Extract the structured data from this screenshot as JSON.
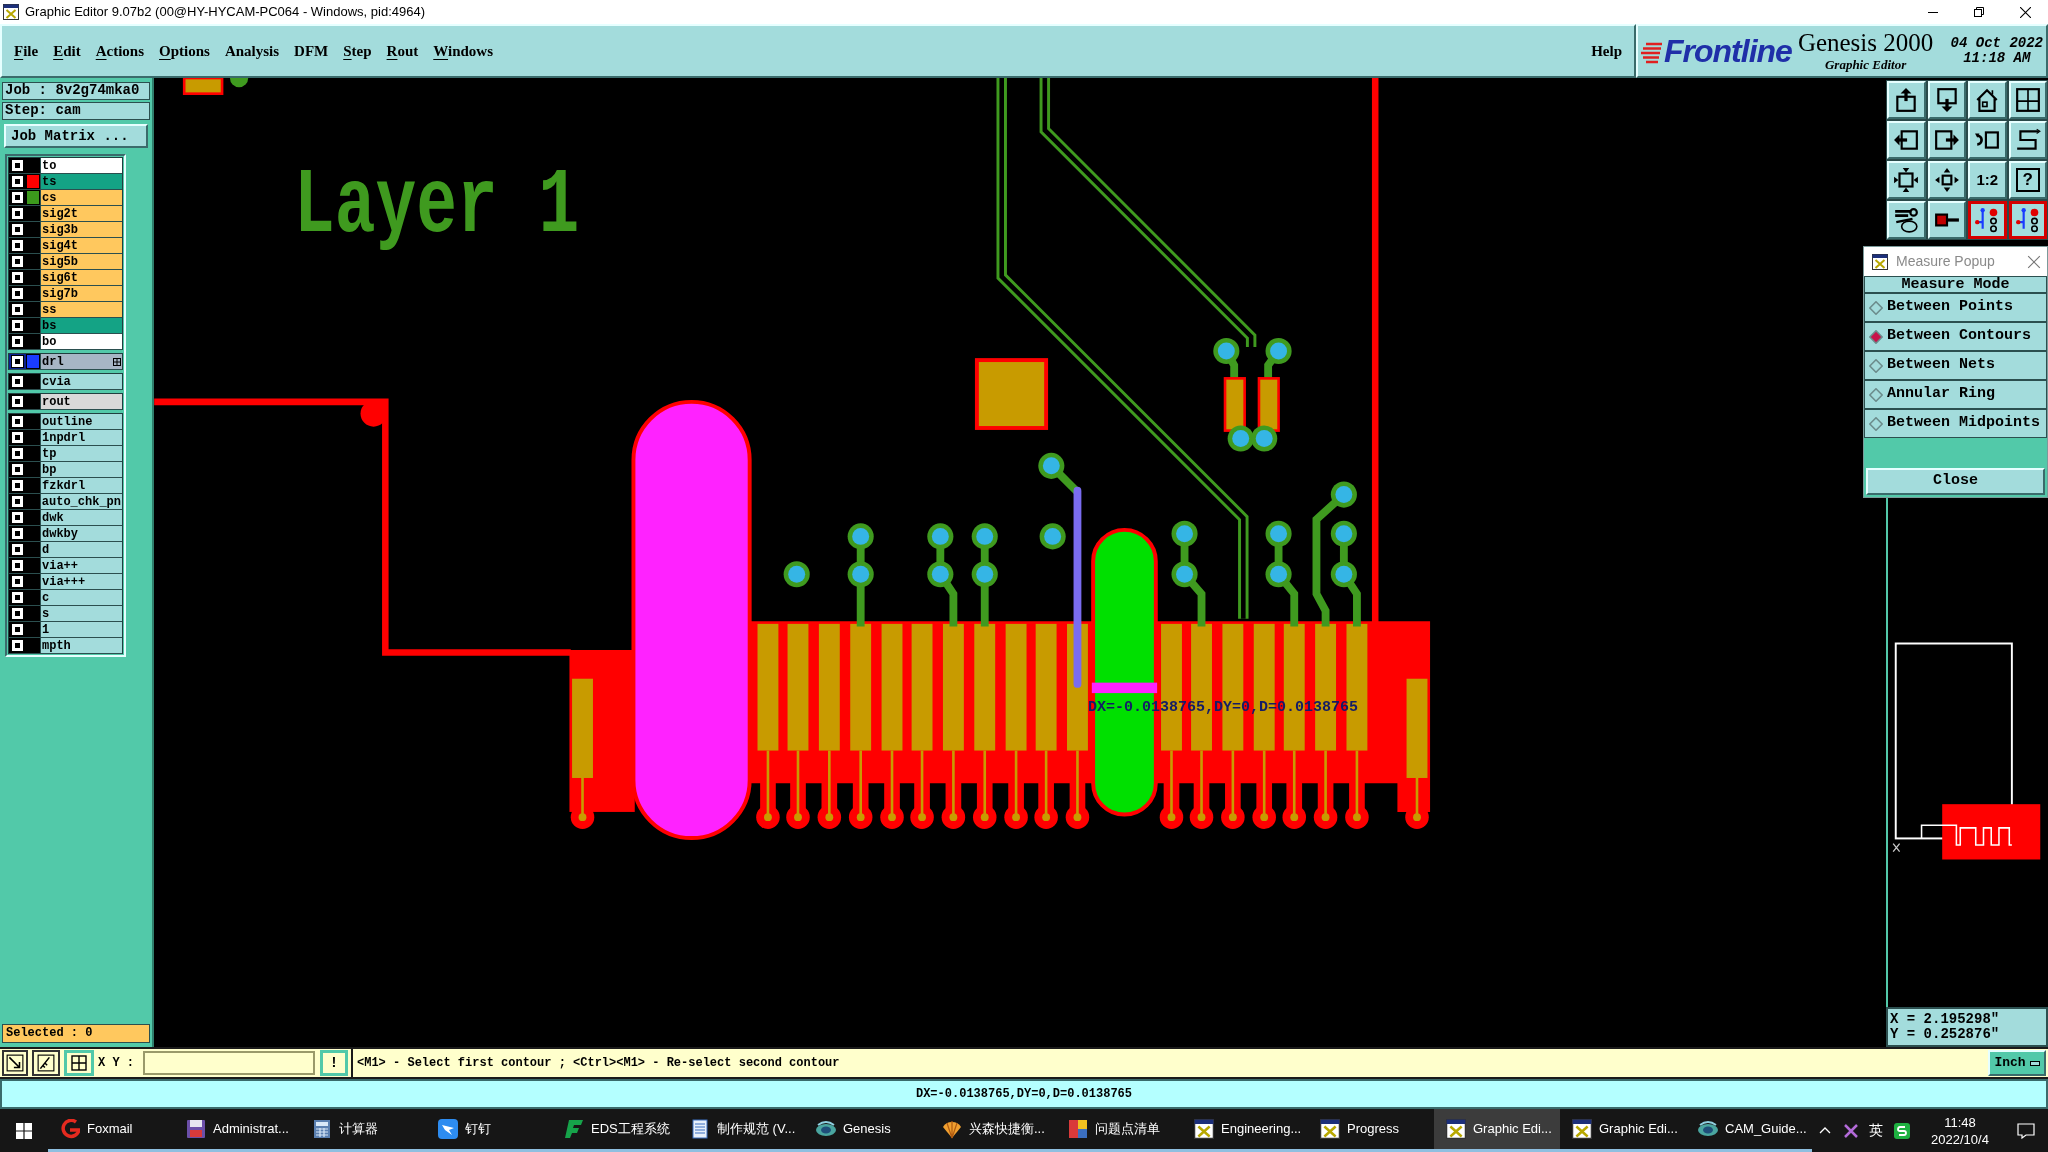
{
  "window": {
    "title": "Graphic Editor 9.07b2 (00@HY-HYCAM-PC064 - Windows, pid:4964)"
  },
  "menu": [
    {
      "label": "File",
      "mnemonic": true
    },
    {
      "label": "Edit",
      "mnemonic": true
    },
    {
      "label": "Actions",
      "mnemonic": true
    },
    {
      "label": "Options",
      "mnemonic": true
    },
    {
      "label": "Analysis",
      "mnemonic": false
    },
    {
      "label": "DFM",
      "mnemonic": false
    },
    {
      "label": "Step",
      "mnemonic": true
    },
    {
      "label": "Rout",
      "mnemonic": true
    },
    {
      "label": "Windows",
      "mnemonic": true
    }
  ],
  "help": {
    "label": "Help",
    "mnemonic": false
  },
  "logo": {
    "brand": "Frontline",
    "product": "Genesis 2000",
    "subtitle": "Graphic Editor",
    "date": "04 Oct 2022",
    "time": "11:18 AM"
  },
  "left_panel": {
    "job": "Job : 8v2g74mka0",
    "step": "Step: cam",
    "matrix_button": "Job Matrix ...",
    "layer_groups": [
      {
        "layers": [
          {
            "name": "to",
            "kind": "silk",
            "selected": false,
            "has_tools": false
          },
          {
            "name": "ts",
            "color": "#ff0000",
            "kind": "mask",
            "selected": false,
            "has_tools": false
          },
          {
            "name": "cs",
            "color": "#3c9a1c",
            "kind": "signal",
            "selected": false,
            "has_tools": false
          },
          {
            "name": "sig2t",
            "kind": "signal",
            "selected": false,
            "has_tools": false
          },
          {
            "name": "sig3b",
            "kind": "signal",
            "selected": false,
            "has_tools": false
          },
          {
            "name": "sig4t",
            "kind": "signal",
            "selected": false,
            "has_tools": false
          },
          {
            "name": "sig5b",
            "kind": "signal",
            "selected": false,
            "has_tools": false
          },
          {
            "name": "sig6t",
            "kind": "signal",
            "selected": false,
            "has_tools": false
          },
          {
            "name": "sig7b",
            "kind": "signal",
            "selected": false,
            "has_tools": false
          },
          {
            "name": "ss",
            "kind": "signal",
            "selected": false,
            "has_tools": false
          },
          {
            "name": "bs",
            "kind": "mask",
            "selected": false,
            "has_tools": false
          },
          {
            "name": "bo",
            "kind": "silk",
            "selected": false,
            "has_tools": false
          }
        ]
      },
      {
        "layers": [
          {
            "name": "drl",
            "color": "#1a3cff",
            "kind": "drill",
            "selected": true,
            "has_tools": true
          }
        ]
      },
      {
        "layers": [
          {
            "name": "cvia",
            "kind": "misc",
            "selected": false,
            "has_tools": false
          }
        ]
      },
      {
        "layers": [
          {
            "name": "rout",
            "kind": "rout",
            "selected": false,
            "has_tools": false
          }
        ]
      },
      {
        "layers": [
          {
            "name": "outline",
            "kind": "misc",
            "selected": false,
            "has_tools": false
          },
          {
            "name": "1npdrl",
            "kind": "misc",
            "selected": false,
            "has_tools": false
          },
          {
            "name": "tp",
            "kind": "misc",
            "selected": false,
            "has_tools": false
          },
          {
            "name": "bp",
            "kind": "misc",
            "selected": false,
            "has_tools": false
          },
          {
            "name": "fzkdrl",
            "kind": "misc",
            "selected": false,
            "has_tools": false
          },
          {
            "name": "auto_chk_pn",
            "kind": "misc",
            "selected": false,
            "has_tools": false
          },
          {
            "name": "dwk",
            "kind": "misc",
            "selected": false,
            "has_tools": false
          },
          {
            "name": "dwkby",
            "kind": "misc",
            "selected": false,
            "has_tools": false
          },
          {
            "name": "d",
            "kind": "misc",
            "selected": false,
            "has_tools": false
          },
          {
            "name": "via++",
            "kind": "misc",
            "selected": false,
            "has_tools": false
          },
          {
            "name": "via+++",
            "kind": "misc",
            "selected": false,
            "has_tools": false
          },
          {
            "name": "c",
            "kind": "misc",
            "selected": false,
            "has_tools": false
          },
          {
            "name": "s",
            "kind": "misc",
            "selected": false,
            "has_tools": false
          },
          {
            "name": "1",
            "kind": "misc",
            "selected": false,
            "has_tools": false
          },
          {
            "name": "mpth",
            "kind": "misc",
            "selected": false,
            "has_tools": false
          }
        ]
      }
    ],
    "selected": "Selected : 0"
  },
  "canvas": {
    "layer_title": "Layer 1",
    "measure_label": "DX=-0.0138765,DY=0,D=0.0138765"
  },
  "toolbar": [
    {
      "kind": "icon",
      "active": false
    },
    {
      "kind": "icon",
      "active": false
    },
    {
      "kind": "icon",
      "active": false
    },
    {
      "kind": "icon",
      "active": false
    },
    {
      "kind": "icon",
      "active": false
    },
    {
      "kind": "icon",
      "active": false
    },
    {
      "kind": "icon",
      "active": false
    },
    {
      "kind": "icon",
      "active": false
    },
    {
      "kind": "icon",
      "active": false
    },
    {
      "kind": "icon",
      "active": false
    },
    {
      "kind": "text",
      "label": "1:2",
      "active": false
    },
    {
      "kind": "text",
      "label": "?",
      "active": false
    },
    {
      "kind": "icon",
      "active": false
    },
    {
      "kind": "icon",
      "active": false
    },
    {
      "kind": "icon",
      "active": true
    },
    {
      "kind": "icon",
      "active": true
    }
  ],
  "measure_popup": {
    "title": "Measure Popup",
    "heading": "Measure Mode",
    "options": [
      {
        "label": "Between Points",
        "selected": false
      },
      {
        "label": "Between Contours",
        "selected": true
      },
      {
        "label": "Between Nets",
        "selected": false
      },
      {
        "label": "Annular Ring",
        "selected": false
      },
      {
        "label": "Between Midpoints",
        "selected": false
      }
    ],
    "close": "Close"
  },
  "readout": {
    "x": "X = 2.195298\"",
    "y": "Y = 0.252876\""
  },
  "command_bar": {
    "xy_label": "X Y :",
    "action": "!",
    "prompt": "<M1> - Select first contour ; <Ctrl><M1> - Re-select second contour",
    "units": "Inch"
  },
  "status_bar": {
    "text": "DX=-0.0138765,DY=0,D=0.0138765"
  },
  "taskbar": {
    "items": [
      {
        "label": "Foxmail",
        "selected": false
      },
      {
        "label": "Administrat...",
        "selected": false
      },
      {
        "label": "计算器",
        "selected": false
      },
      {
        "label": "钉钉",
        "selected": false
      },
      {
        "label": "EDS工程系统",
        "selected": false
      },
      {
        "label": "制作规范 (V...",
        "selected": false
      },
      {
        "label": "Genesis",
        "selected": false
      },
      {
        "label": "兴森快捷衡...",
        "selected": false
      },
      {
        "label": "问题点清单",
        "selected": false
      },
      {
        "label": "Engineering...",
        "selected": false
      },
      {
        "label": "Progress",
        "selected": false
      },
      {
        "label": "Graphic Edi...",
        "selected": true
      },
      {
        "label": "Graphic Edi...",
        "selected": false
      },
      {
        "label": "CAM_Guide...",
        "selected": false
      }
    ],
    "tray": {
      "language": "英",
      "time": "11:48",
      "date": "2022/10/4"
    }
  }
}
